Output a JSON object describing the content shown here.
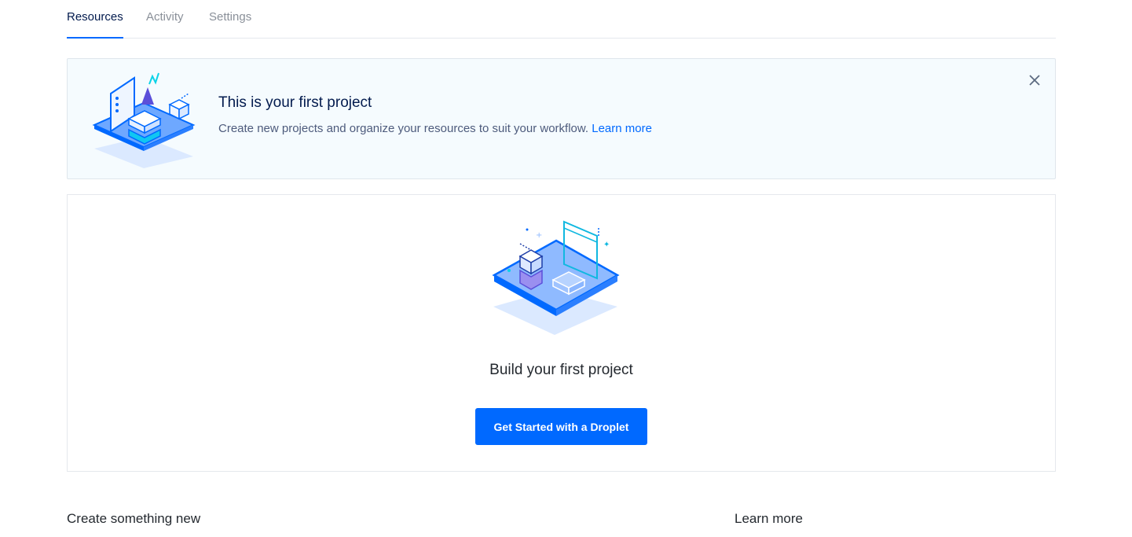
{
  "tabs": [
    {
      "label": "Resources",
      "active": true
    },
    {
      "label": "Activity",
      "active": false
    },
    {
      "label": "Settings",
      "active": false
    }
  ],
  "notice": {
    "title": "This is your first project",
    "description": "Create new projects and organize your resources to suit your workflow.",
    "link_label": "Learn more",
    "close_icon": "close-icon",
    "illustration_icon": "project-isometric-illustration"
  },
  "empty_state": {
    "title": "Build your first project",
    "button_label": "Get Started with a Droplet",
    "illustration_icon": "droplet-isometric-illustration"
  },
  "sections": {
    "create_heading": "Create something new",
    "learn_heading": "Learn more"
  },
  "colors": {
    "accent": "#0069ff",
    "notice_bg": "#f5fbfe",
    "heading": "#031b4e",
    "muted_tab": "#8a9099"
  }
}
